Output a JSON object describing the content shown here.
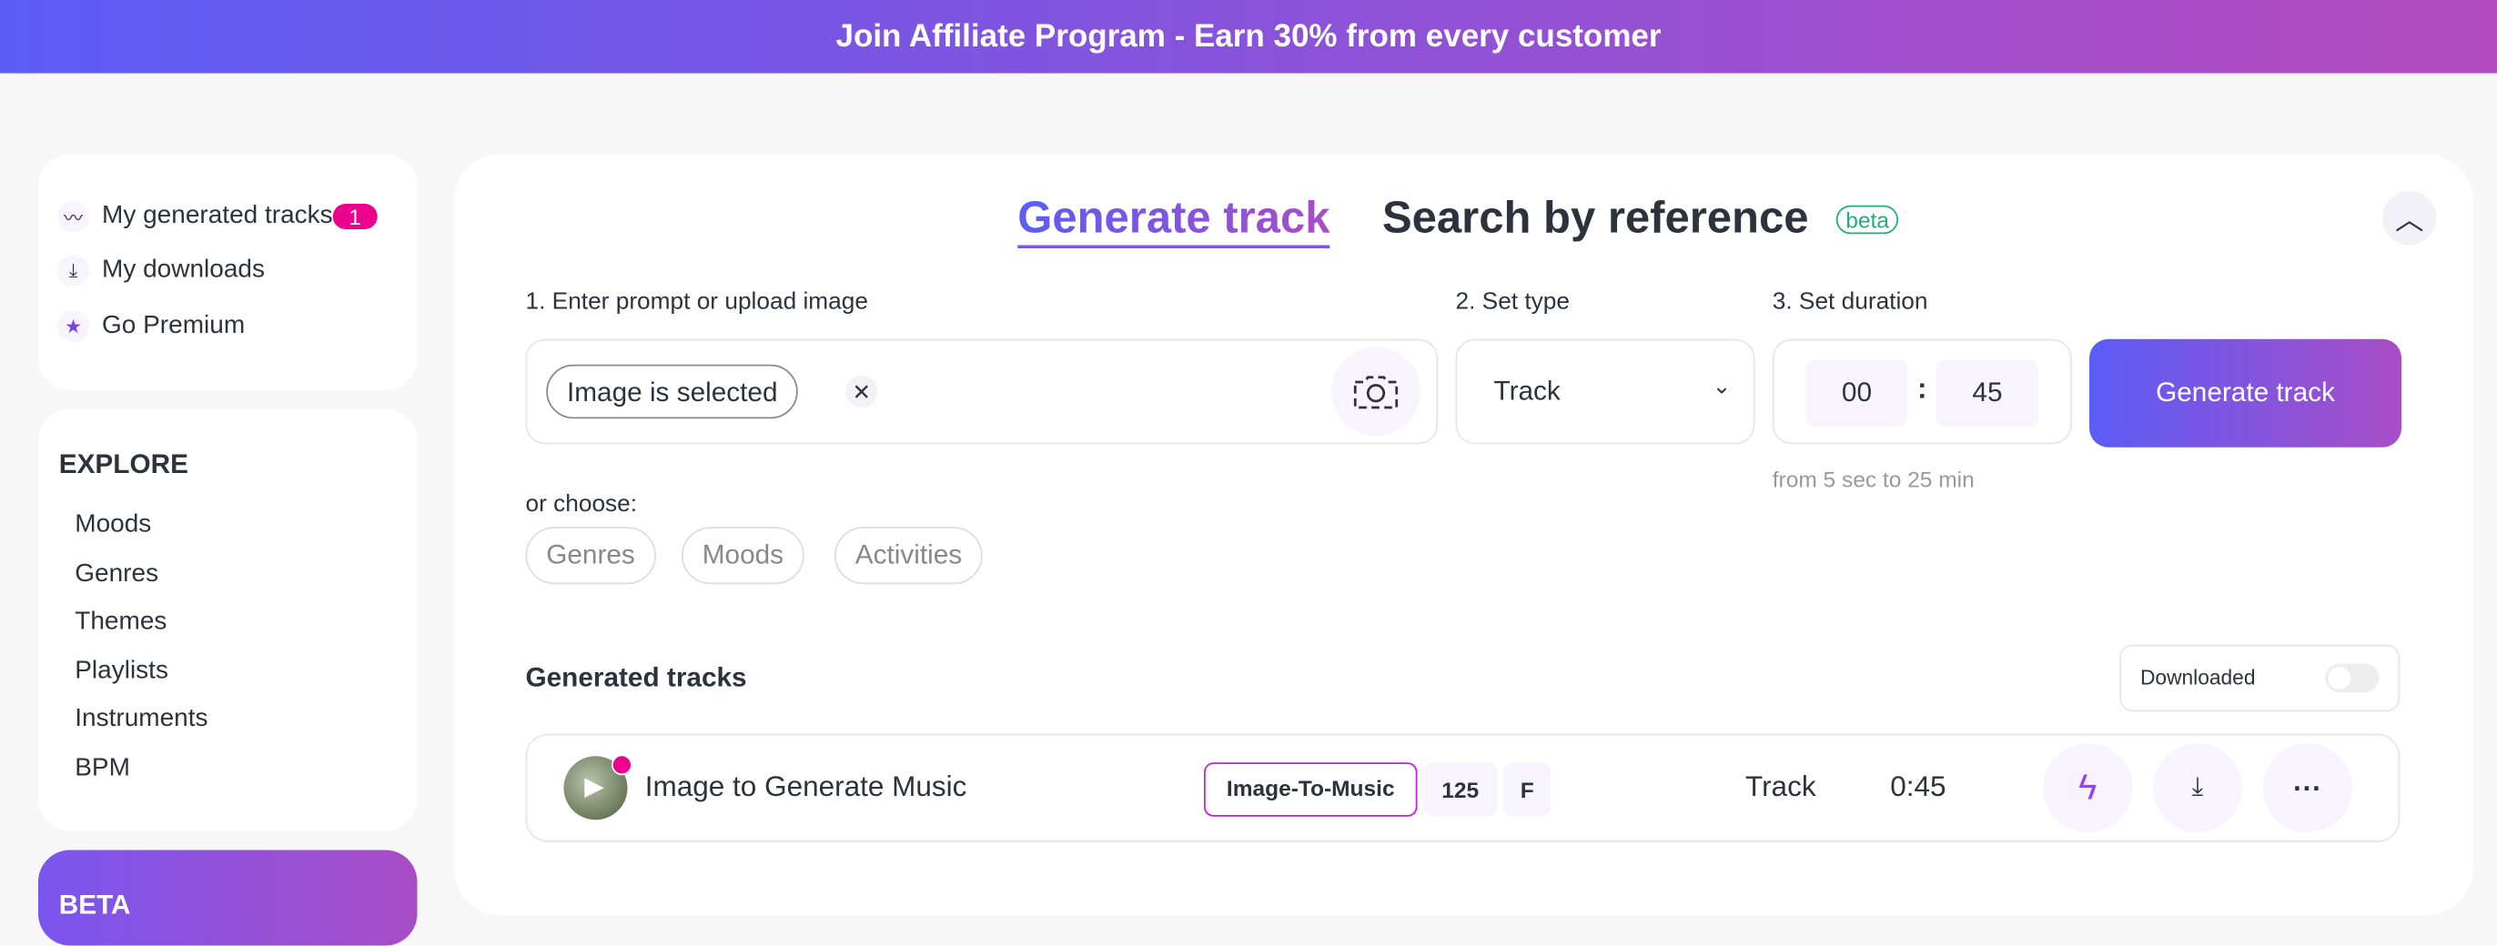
{
  "banner": {
    "text": "Join Affiliate Program - Earn 30% from every customer"
  },
  "sidebar": {
    "items": [
      {
        "label": "My generated tracks",
        "icon": "wave-icon",
        "badge": "1"
      },
      {
        "label": "My downloads",
        "icon": "download-icon"
      },
      {
        "label": "Go Premium",
        "icon": "star-icon"
      }
    ],
    "explore_title": "EXPLORE",
    "explore": [
      "Moods",
      "Genres",
      "Themes",
      "Playlists",
      "Instruments",
      "BPM"
    ],
    "beta_title": "BETA"
  },
  "main": {
    "tabs": [
      "Generate track",
      "Search by reference"
    ],
    "beta_badge": "beta",
    "step1": "1. Enter prompt or upload image",
    "step2": "2. Set type",
    "step3": "3. Set duration",
    "image_chip": "Image is selected",
    "type_value": "Track",
    "minutes": "00",
    "colon": ":",
    "seconds": "45",
    "duration_hint": "from 5 sec to 25 min",
    "generate_label": "Generate track",
    "or_choose": "or choose:",
    "choose": [
      "Genres",
      "Moods",
      "Activities"
    ],
    "generated_title": "Generated tracks",
    "downloaded_label": "Downloaded",
    "downloaded_on": false,
    "track": {
      "title": "Image to Generate Music",
      "tag": "Image-To-Music",
      "bpm": "125",
      "key": "F",
      "type": "Track",
      "duration": "0:45"
    }
  },
  "colors": {
    "accent_start": "#5b5cf6",
    "accent_end": "#a94dc6",
    "badge": "#ec008c"
  }
}
